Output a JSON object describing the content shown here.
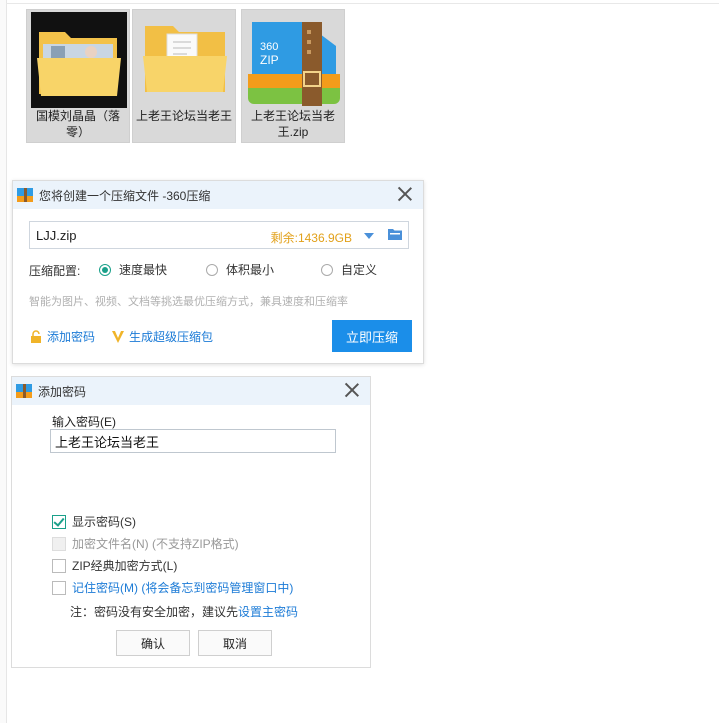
{
  "files": [
    {
      "name": "国模刘晶晶（落零）"
    },
    {
      "name": "上老王论坛当老王"
    },
    {
      "name": "上老王论坛当老王.zip",
      "badge": "360\nZIP"
    }
  ],
  "compress_dialog": {
    "title": "您将创建一个压缩文件 -360压缩",
    "path_value": "LJJ.zip",
    "free_space": "剩余:1436.9GB",
    "config_label": "压缩配置:",
    "options": [
      "速度最快",
      "体积最小",
      "自定义"
    ],
    "selected_option": "速度最快",
    "hint": "智能为图片、视频、文档等挑选最优压缩方式，兼具速度和压缩率",
    "add_password": "添加密码",
    "super_pack": "生成超级压缩包",
    "compress_now": "立即压缩",
    "colors": {
      "accent": "#1b8ee9",
      "green": "#1aa08a",
      "orange": "#e2a11b"
    }
  },
  "password_dialog": {
    "title": "添加密码",
    "input_label": "输入密码(E)",
    "password_value": "上老王论坛当老王",
    "checkboxes": [
      {
        "label": "显示密码(S)",
        "checked": true,
        "disabled": false
      },
      {
        "label": "加密文件名(N) (不支持ZIP格式)",
        "checked": false,
        "disabled": true
      },
      {
        "label": "ZIP经典加密方式(L)",
        "checked": false,
        "disabled": false
      },
      {
        "label": "记住密码(M) (将会备忘到密码管理窗口中)",
        "checked": false,
        "disabled": false
      }
    ],
    "note_prefix": "注：密码没有安全加密，建议先",
    "note_link": "设置主密码",
    "ok": "确认",
    "cancel": "取消"
  }
}
